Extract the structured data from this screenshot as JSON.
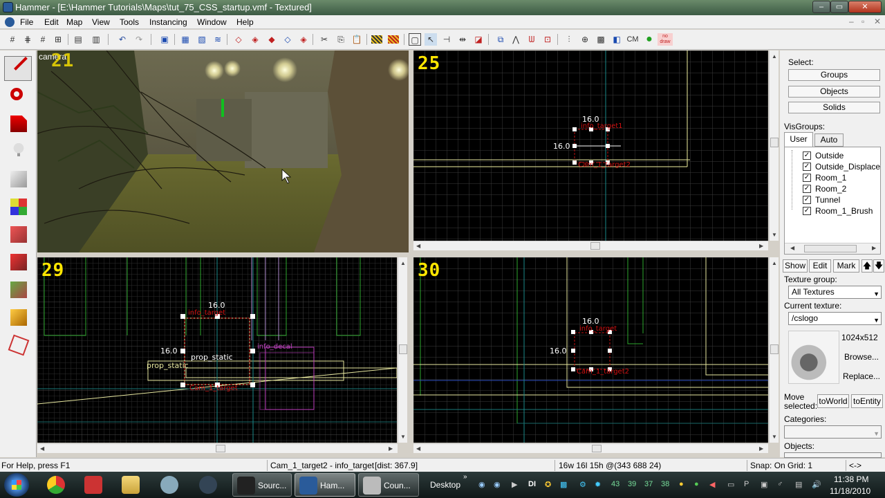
{
  "window": {
    "title": "Hammer - [E:\\Hammer Tutorials\\Maps\\tut_75_CSS_startup.vmf - Textured]",
    "minimize": "–",
    "maximize": "▭",
    "close": "✕"
  },
  "menu": [
    "File",
    "Edit",
    "Map",
    "View",
    "Tools",
    "Instancing",
    "Window",
    "Help"
  ],
  "mdi_controls": [
    "–",
    "▫",
    "✕"
  ],
  "toolbar_extra": {
    "cm": "CM",
    "nodraw": "no draw"
  },
  "viewports": {
    "camera": {
      "label": "camera"
    },
    "top": {
      "label": "25",
      "dim_w": "16.0",
      "dim_h": "16.0",
      "ent1": "info_target1",
      "ent2": "Cam_1_target2"
    },
    "front": {
      "label": "29",
      "dim_w": "16.0",
      "dim_h": "16.0",
      "p1": "prop_static",
      "p2": "prop_static",
      "ent1": "info_target",
      "ent2": "Cam_1_target",
      "ent3": "info_decal"
    },
    "side": {
      "label": "30",
      "dim_w": "16.0",
      "dim_h": "16.0",
      "ent1": "info_target",
      "ent2": "Cam_1_target2"
    }
  },
  "right_panel": {
    "select_label": "Select:",
    "select_buttons": [
      "Groups",
      "Objects",
      "Solids"
    ],
    "visgroups_label": "VisGroups:",
    "tabs": [
      "User",
      "Auto"
    ],
    "visgroups": [
      {
        "name": "Outside",
        "checked": true
      },
      {
        "name": "Outside_Displacem",
        "checked": true
      },
      {
        "name": "Room_1",
        "checked": true
      },
      {
        "name": "Room_2",
        "checked": true
      },
      {
        "name": "Tunnel",
        "checked": true
      },
      {
        "name": "Room_1_Brush",
        "checked": true
      }
    ],
    "vg_buttons": [
      "Show",
      "Edit",
      "Mark"
    ],
    "texture_group_label": "Texture group:",
    "texture_group_value": "All Textures",
    "current_texture_label": "Current texture:",
    "current_texture_value": "/cslogo",
    "texture_size": "1024x512",
    "browse_label": "Browse...",
    "replace_label": "Replace...",
    "move_selected_label": "Move selected:",
    "to_world_label": "toWorld",
    "to_entity_label": "toEntity",
    "categories_label": "Categories:",
    "objects_label": "Objects:"
  },
  "status_bar": {
    "help": "For Help, press F1",
    "selection": "Cam_1_target2 - info_target",
    "dist": "[dist: 367.9]",
    "size": "16w 16l 15h @(343 688 24)",
    "snap": "Snap: On Grid: 1",
    "arrows": "<->"
  },
  "taskbar": {
    "items": [
      {
        "label": "Sourc...",
        "state": "open"
      },
      {
        "label": "Ham...",
        "state": "active"
      },
      {
        "label": "Coun...",
        "state": "open"
      }
    ],
    "desktop": "Desktop",
    "tray_numbers": [
      "43",
      "39",
      "37",
      "38"
    ],
    "di": "DI",
    "time": "11:38 PM",
    "date": "11/18/2010"
  },
  "colors": {
    "title_bar": "#3c5a44",
    "grid_minor": "#3a3a3a",
    "grid_major": "#5a5a5a",
    "viewport_label": "#ffe600",
    "entity_red": "#d01010",
    "selection_box": "#ffffff"
  }
}
